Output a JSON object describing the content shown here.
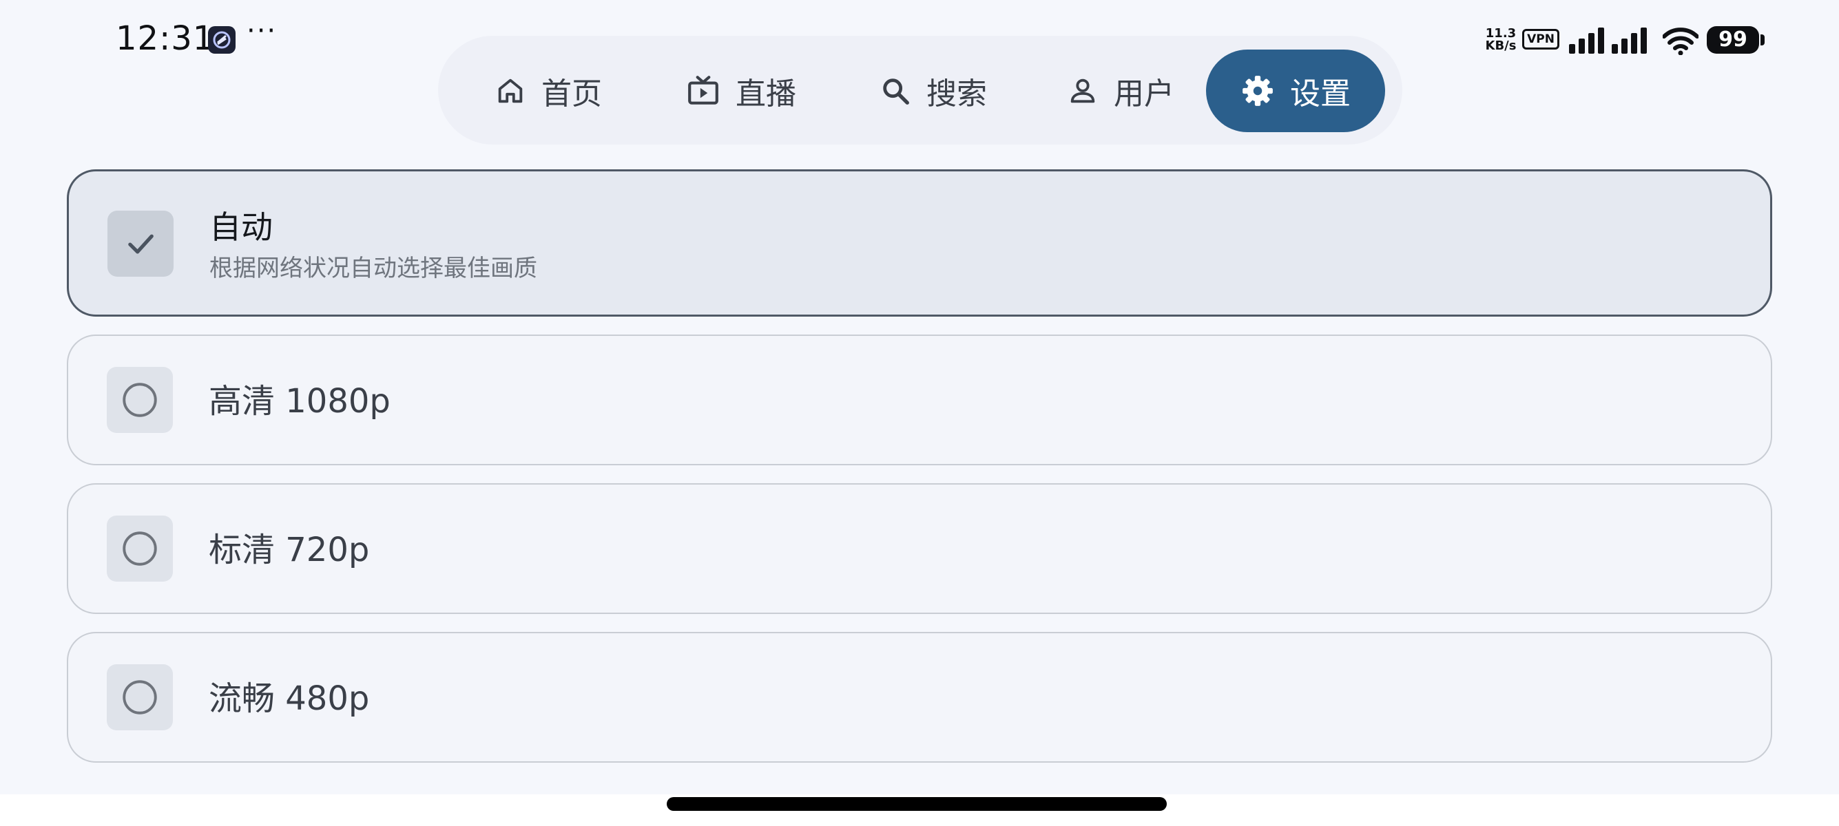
{
  "status_bar": {
    "time": "12:31",
    "more": "···",
    "net_speed_value": "11.3",
    "net_speed_unit": "KB/s",
    "vpn": "VPN",
    "battery": "99"
  },
  "nav": {
    "items": [
      {
        "label": "首页",
        "icon": "home-icon"
      },
      {
        "label": "直播",
        "icon": "tv-icon"
      },
      {
        "label": "搜索",
        "icon": "search-icon"
      },
      {
        "label": "用户",
        "icon": "user-icon"
      },
      {
        "label": "设置",
        "icon": "gear-icon",
        "active": true
      }
    ]
  },
  "options": [
    {
      "title": "自动",
      "subtitle": "根据网络状况自动选择最佳画质",
      "selected": true
    },
    {
      "title": "高清 1080p",
      "selected": false
    },
    {
      "title": "标清 720p",
      "selected": false
    },
    {
      "title": "流畅 480p",
      "selected": false
    }
  ],
  "colors": {
    "accent": "#2b5f8c",
    "background": "#f5f7fc",
    "selected_card": "#e5e9f1"
  }
}
